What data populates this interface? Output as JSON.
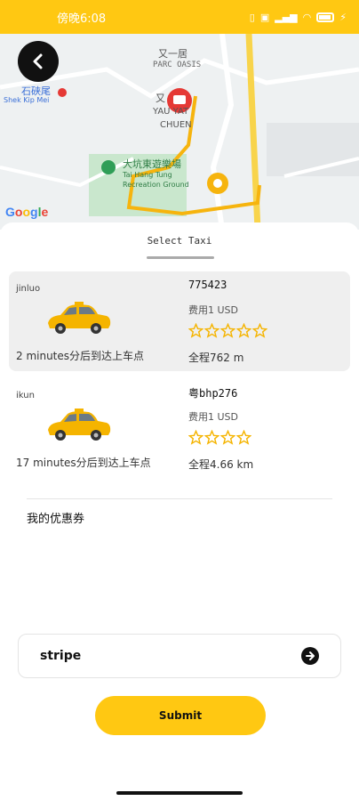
{
  "status_bar": {
    "time": "傍晚6:08",
    "battery": "100"
  },
  "map": {
    "labels": [
      "又一居",
      "PARC OASIS",
      "石硤尾",
      "Shek Kip Mei",
      "大坑東遊樂場",
      "Tai Hang Tung",
      "Recreation Ground",
      "YAU YAT",
      "CHUEN",
      "又"
    ],
    "attribution": "Google"
  },
  "sheet": {
    "title": "Select Taxi"
  },
  "taxis": [
    {
      "driver": "jinluo",
      "eta": "2 minutes分后到达上车点",
      "plate": "775423",
      "fee": "费用1 USD",
      "rating": 5,
      "distance": "全程762 m",
      "selected": true
    },
    {
      "driver": "ikun",
      "eta": "17 minutes分后到达上车点",
      "plate": "粤bhp276",
      "fee": "费用1 USD",
      "rating": 4,
      "distance": "全程4.66 km",
      "selected": false
    }
  ],
  "coupon": {
    "label": "我的优惠券"
  },
  "payment": {
    "method": "stripe",
    "arrow_icon": "arrow-right-circle-icon"
  },
  "submit": {
    "label": "Submit"
  },
  "colors": {
    "accent": "#FFC812",
    "star": "#F5B400",
    "route": "#F6B40E",
    "marker_red": "#E53935"
  }
}
